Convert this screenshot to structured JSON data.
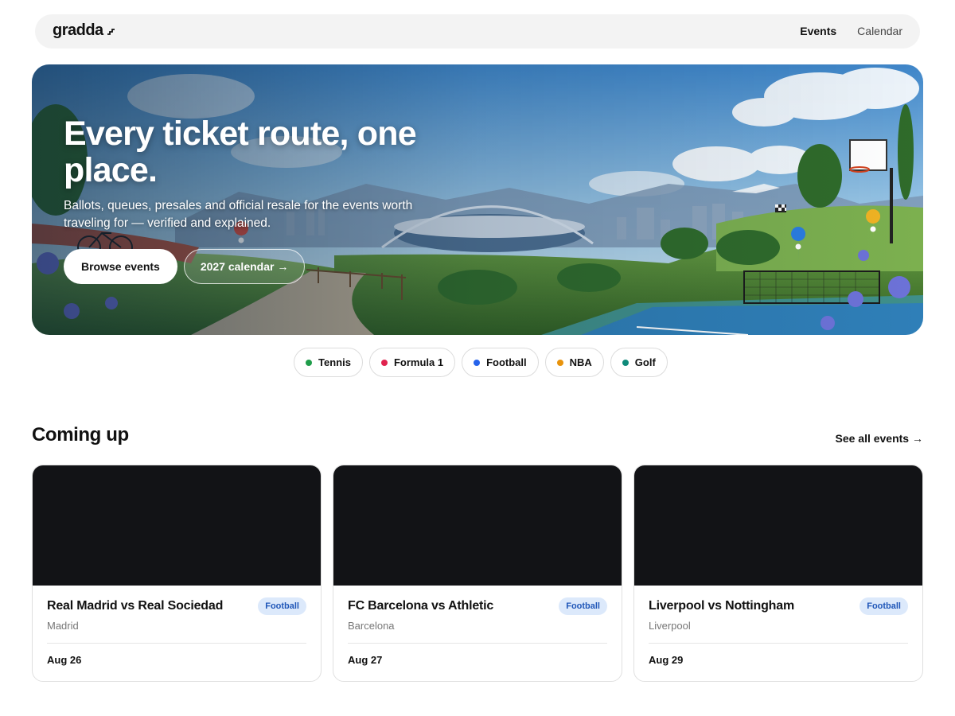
{
  "nav": {
    "logo": "gradda",
    "links": [
      {
        "label": "Events",
        "active": true
      },
      {
        "label": "Calendar",
        "active": false
      }
    ]
  },
  "hero": {
    "title": "Every ticket route, one place.",
    "subtitle": "Ballots, queues, presales and official resale for the events worth traveling for — verified and explained.",
    "primary_button": "Browse events",
    "secondary_button": "2027 calendar →"
  },
  "categories": [
    {
      "label": "Tennis",
      "color": "#1f9d4a"
    },
    {
      "label": "Formula 1",
      "color": "#e0234e"
    },
    {
      "label": "Football",
      "color": "#2563eb"
    },
    {
      "label": "NBA",
      "color": "#e8930c"
    },
    {
      "label": "Golf",
      "color": "#0f8a7a"
    }
  ],
  "coming_up": {
    "title": "Coming up",
    "see_all": "See all events →",
    "events": [
      {
        "title": "Real Madrid vs Real Sociedad",
        "city": "Madrid",
        "badge": "Football",
        "date": "Aug 26"
      },
      {
        "title": "FC Barcelona vs Athletic",
        "city": "Barcelona",
        "badge": "Football",
        "date": "Aug 27"
      },
      {
        "title": "Liverpool vs Nottingham",
        "city": "Liverpool",
        "badge": "Football",
        "date": "Aug 29"
      }
    ]
  },
  "colors": {
    "accent_badge_bg": "#dce9fb",
    "accent_badge_text": "#1f56b8",
    "card_image_bg": "#121316"
  }
}
